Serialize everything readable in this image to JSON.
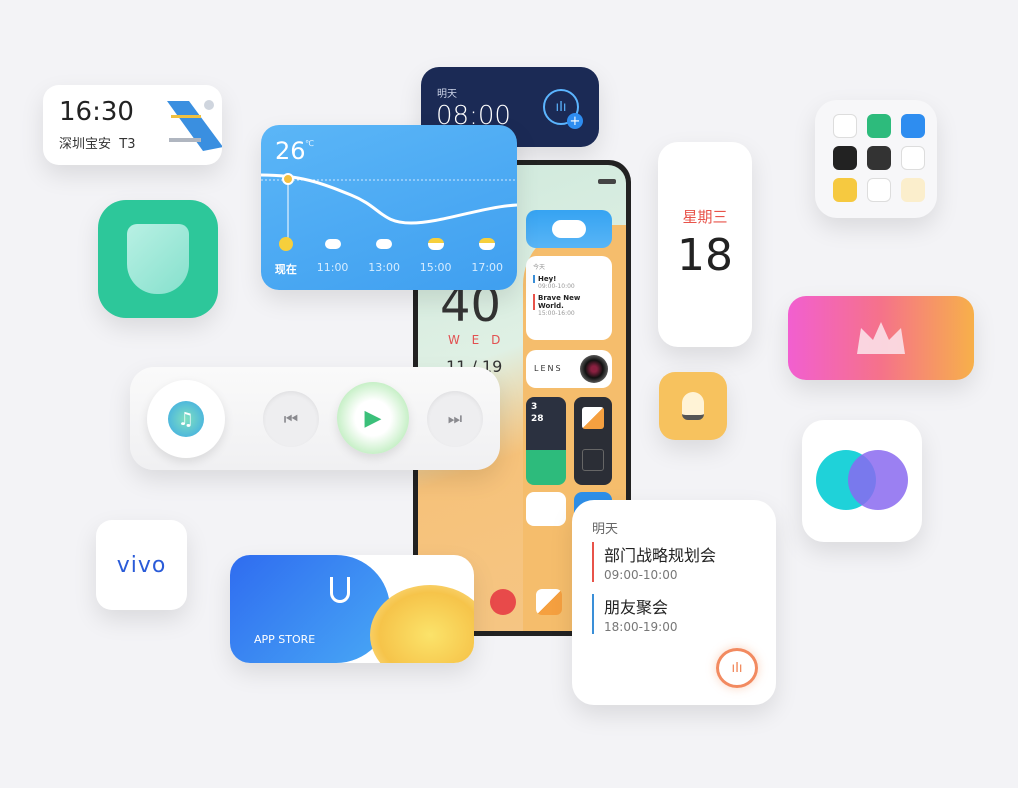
{
  "flight": {
    "time": "16:30",
    "airport": "深圳宝安  T3"
  },
  "alarm": {
    "label": "明天",
    "time": "08:00"
  },
  "weather": {
    "temp": "26",
    "unit": "℃",
    "hours": [
      "现在",
      "11:00",
      "13:00",
      "15:00",
      "17:00"
    ],
    "icons": [
      "sun-icon",
      "rain-cloud-icon",
      "rain-cloud-icon",
      "partly-cloudy-icon",
      "partly-cloudy-icon"
    ]
  },
  "phone": {
    "clock_digits": "40",
    "weekday": "W E D",
    "date": "11 / 19",
    "notes": {
      "header": "今天",
      "items": [
        {
          "title": "Hey!",
          "time": "09:00-10:00"
        },
        {
          "title": "Brave New World.",
          "time": "15:00-16:00"
        }
      ]
    },
    "lens": "LENS",
    "steps": {
      "a": "3",
      "b": "28"
    }
  },
  "date_widget": {
    "weekday": "星期三",
    "day": "18"
  },
  "calendar": {
    "label": "明天",
    "events": [
      {
        "title": "部门战略规划会",
        "time": "09:00-10:00",
        "color": "#e8534a"
      },
      {
        "title": "朋友聚会",
        "time": "18:00-19:00",
        "color": "#3a8fd8"
      }
    ]
  },
  "app_store": {
    "label": "APP STORE"
  },
  "vivo": {
    "logo": "vivo"
  },
  "colors": {
    "green": "#2dc79a",
    "navy": "#1b2a55",
    "blue": "#4aa9f4",
    "accent_red": "#e8534a"
  }
}
